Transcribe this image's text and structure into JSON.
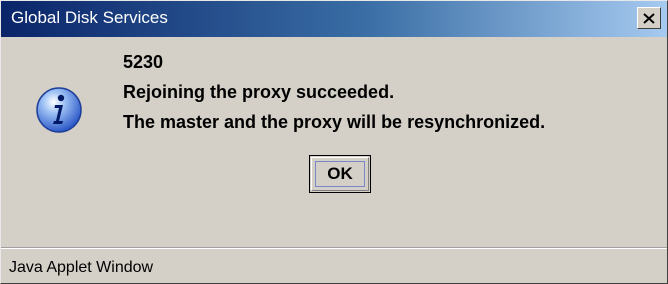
{
  "window": {
    "title": "Global Disk Services",
    "close_icon": "close-icon"
  },
  "dialog": {
    "icon": "info-icon",
    "message_code": "5230",
    "message_line1": "Rejoining the proxy succeeded.",
    "message_line2": "The master and the proxy will be resynchronized.",
    "ok_label": "OK"
  },
  "status_bar": {
    "text": "Java Applet Window"
  },
  "colors": {
    "titlebar_start": "#0a246a",
    "titlebar_end": "#a6caf0",
    "dialog_background": "#d4d0c8",
    "icon_blue": "#2a56c6"
  }
}
